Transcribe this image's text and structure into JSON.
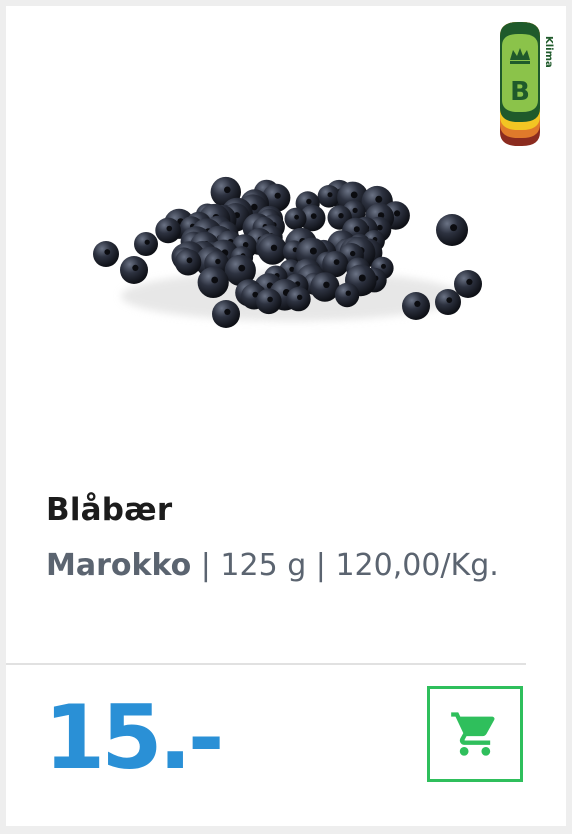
{
  "product": {
    "name": "Blåbær",
    "origin": "Marokko",
    "separator1": " | ",
    "weight": "125 g",
    "separator2": " | ",
    "unit_price": "120,00/Kg."
  },
  "price": {
    "label": "15.-"
  },
  "climate_label": {
    "grade": "B",
    "text": "Klima"
  },
  "colors": {
    "price": "#2a90d6",
    "cart": "#2fbf5c",
    "climate_green": "#8bc34a",
    "climate_dark": "#1f5a2b"
  },
  "icons": {
    "cart": "cart-icon",
    "crown": "crown-icon",
    "product": "blueberries-image"
  }
}
